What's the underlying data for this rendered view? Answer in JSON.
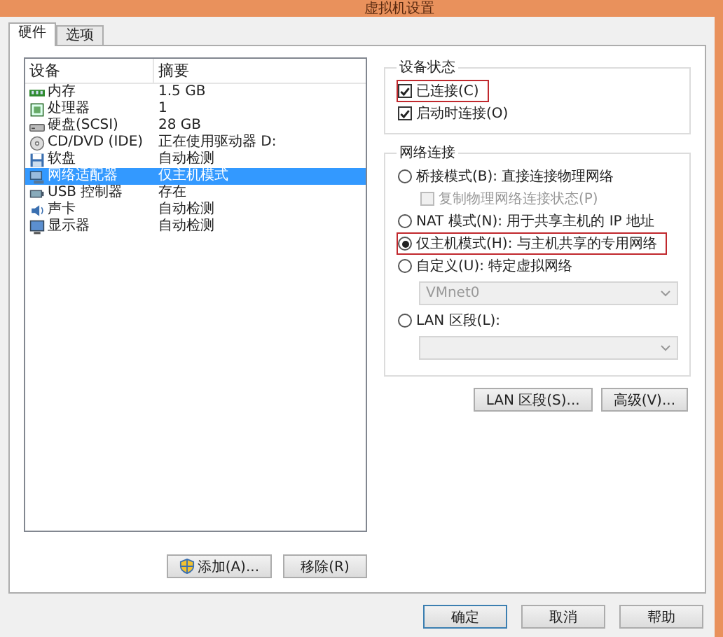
{
  "window": {
    "title": "虚拟机设置"
  },
  "tabs": [
    {
      "label": "硬件",
      "selected": true
    },
    {
      "label": "选项",
      "selected": false
    }
  ],
  "devices": {
    "columns": [
      "设备",
      "摘要"
    ],
    "rows": [
      {
        "name": "内存",
        "summary": "1.5 GB",
        "selected": false
      },
      {
        "name": "处理器",
        "summary": "1",
        "selected": false
      },
      {
        "name": "硬盘(SCSI)",
        "summary": "28 GB",
        "selected": false
      },
      {
        "name": "CD/DVD (IDE)",
        "summary": "正在使用驱动器 D:",
        "selected": false
      },
      {
        "name": "软盘",
        "summary": "自动检测",
        "selected": false
      },
      {
        "name": "网络适配器",
        "summary": "仅主机模式",
        "selected": true
      },
      {
        "name": "USB 控制器",
        "summary": "存在",
        "selected": false
      },
      {
        "name": "声卡",
        "summary": "自动检测",
        "selected": false
      },
      {
        "name": "显示器",
        "summary": "自动检测",
        "selected": false
      }
    ],
    "buttons": [
      {
        "label": "添加(A)...",
        "shield": true
      },
      {
        "label": "移除(R)",
        "shield": false
      }
    ]
  },
  "device_status": {
    "title": "设备状态",
    "options": [
      {
        "label": "已连接(C)",
        "checked": true,
        "highlighted": true
      },
      {
        "label": "启动时连接(O)",
        "checked": true,
        "highlighted": false
      }
    ]
  },
  "network_connection": {
    "title": "网络连接",
    "items": [
      {
        "kind": "radio",
        "label": "桥接模式(B): 直接连接物理网络",
        "selected": false,
        "highlighted": false
      },
      {
        "kind": "subcheck",
        "label": "复制物理网络连接状态(P)",
        "checked": false,
        "disabled": true
      },
      {
        "kind": "radio",
        "label": "NAT 模式(N): 用于共享主机的 IP 地址",
        "selected": false,
        "highlighted": false
      },
      {
        "kind": "radio",
        "label": "仅主机模式(H): 与主机共享的专用网络",
        "selected": true,
        "highlighted": true
      },
      {
        "kind": "radio",
        "label": "自定义(U): 特定虚拟网络",
        "selected": false,
        "highlighted": false
      },
      {
        "kind": "dropdown",
        "value": "VMnet0",
        "disabled": true
      },
      {
        "kind": "radio",
        "label": "LAN 区段(L):",
        "selected": false,
        "highlighted": false
      },
      {
        "kind": "dropdown",
        "disabled": true
      }
    ]
  },
  "panel_buttons": [
    "LAN 区段(S)...",
    "高级(V)..."
  ],
  "dialog_buttons": [
    {
      "label": "确定",
      "default": true
    },
    {
      "label": "取消",
      "default": false
    },
    {
      "label": "帮助",
      "default": false
    }
  ]
}
